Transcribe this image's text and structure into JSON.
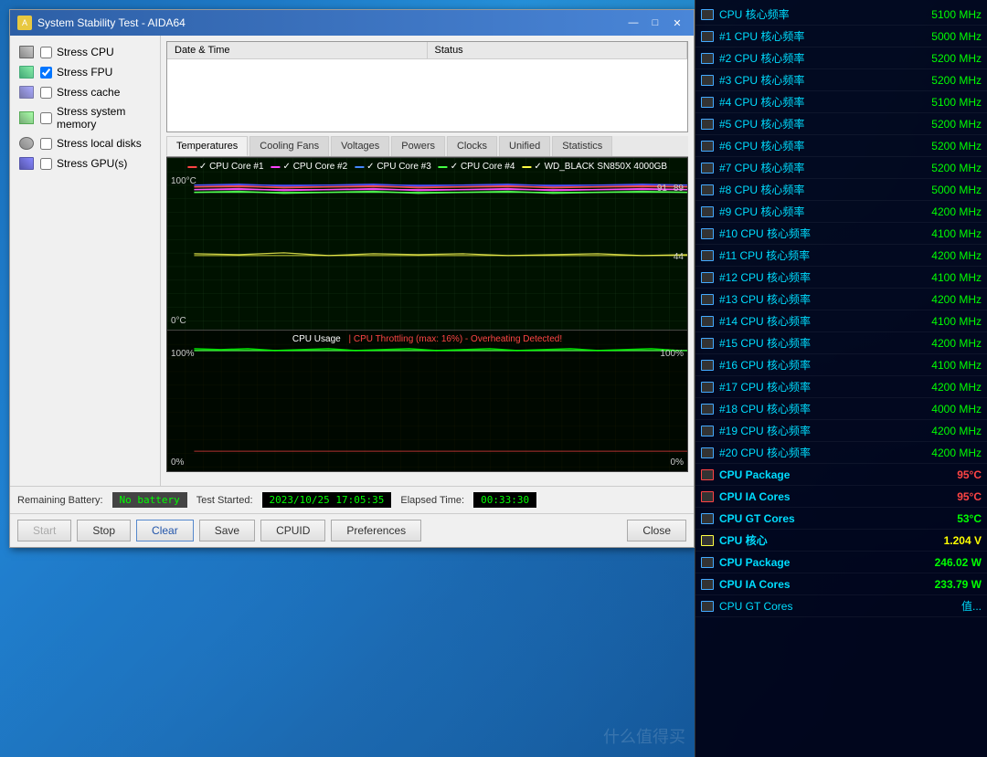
{
  "window": {
    "title": "System Stability Test - AIDA64",
    "icon": "A"
  },
  "controls": {
    "title_buttons": {
      "minimize": "—",
      "maximize": "□",
      "close": "✕"
    }
  },
  "checkboxes": [
    {
      "id": "stress_cpu",
      "label": "Stress CPU",
      "checked": false,
      "icon": "cpu"
    },
    {
      "id": "stress_fpu",
      "label": "Stress FPU",
      "checked": true,
      "icon": "fpu"
    },
    {
      "id": "stress_cache",
      "label": "Stress cache",
      "checked": false,
      "icon": "cache"
    },
    {
      "id": "stress_memory",
      "label": "Stress system memory",
      "checked": false,
      "icon": "mem"
    },
    {
      "id": "stress_disks",
      "label": "Stress local disks",
      "checked": false,
      "icon": "disk"
    },
    {
      "id": "stress_gpu",
      "label": "Stress GPU(s)",
      "checked": false,
      "icon": "gpu"
    }
  ],
  "log": {
    "columns": [
      "Date & Time",
      "Status"
    ],
    "rows": []
  },
  "tabs": [
    {
      "id": "temperatures",
      "label": "Temperatures",
      "active": true
    },
    {
      "id": "cooling_fans",
      "label": "Cooling Fans",
      "active": false
    },
    {
      "id": "voltages",
      "label": "Voltages",
      "active": false
    },
    {
      "id": "powers",
      "label": "Powers",
      "active": false
    },
    {
      "id": "clocks",
      "label": "Clocks",
      "active": false
    },
    {
      "id": "unified",
      "label": "Unified",
      "active": false
    },
    {
      "id": "statistics",
      "label": "Statistics",
      "active": false
    }
  ],
  "temp_chart": {
    "y_max": "100°C",
    "y_min": "0°C",
    "val_91": "91",
    "val_89": "89",
    "val_44": "44",
    "legend": [
      {
        "label": "CPU Core #1",
        "color": "#ff4444"
      },
      {
        "label": "CPU Core #2",
        "color": "#ff44ff"
      },
      {
        "label": "CPU Core #3",
        "color": "#4444ff"
      },
      {
        "label": "CPU Core #4",
        "color": "#44ff44"
      },
      {
        "label": "WD_BLACK SN850X 4000GB",
        "color": "#ffff44"
      }
    ]
  },
  "cpu_chart": {
    "title_normal": "CPU Usage",
    "title_throttle": "CPU Throttling (max: 16%) - Overheating Detected!",
    "y_max_left": "100%",
    "y_min_left": "0%",
    "y_max_right": "100%",
    "y_min_right": "0%"
  },
  "status_bar": {
    "battery_label": "Remaining Battery:",
    "battery_value": "No battery",
    "started_label": "Test Started:",
    "started_value": "2023/10/25 17:05:35",
    "elapsed_label": "Elapsed Time:",
    "elapsed_value": "00:33:30"
  },
  "buttons": [
    {
      "id": "start",
      "label": "Start",
      "disabled": true
    },
    {
      "id": "stop",
      "label": "Stop",
      "disabled": false
    },
    {
      "id": "clear",
      "label": "Clear",
      "disabled": false
    },
    {
      "id": "save",
      "label": "Save",
      "disabled": false
    },
    {
      "id": "cpuid",
      "label": "CPUID",
      "disabled": false
    },
    {
      "id": "preferences",
      "label": "Preferences",
      "disabled": false
    },
    {
      "id": "close",
      "label": "Close",
      "disabled": false
    }
  ],
  "stats": [
    {
      "name": "CPU 核心频率",
      "value": "5100 MHz",
      "color": "green"
    },
    {
      "name": "#1 CPU 核心频率",
      "value": "5000 MHz",
      "color": "green"
    },
    {
      "name": "#2 CPU 核心频率",
      "value": "5200 MHz",
      "color": "green"
    },
    {
      "name": "#3 CPU 核心频率",
      "value": "5200 MHz",
      "color": "green"
    },
    {
      "name": "#4 CPU 核心频率",
      "value": "5100 MHz",
      "color": "green"
    },
    {
      "name": "#5 CPU 核心频率",
      "value": "5200 MHz",
      "color": "green"
    },
    {
      "name": "#6 CPU 核心频率",
      "value": "5200 MHz",
      "color": "green"
    },
    {
      "name": "#7 CPU 核心频率",
      "value": "5200 MHz",
      "color": "green"
    },
    {
      "name": "#8 CPU 核心频率",
      "value": "5000 MHz",
      "color": "green"
    },
    {
      "name": "#9 CPU 核心频率",
      "value": "4200 MHz",
      "color": "green"
    },
    {
      "name": "#10 CPU 核心频率",
      "value": "4100 MHz",
      "color": "green"
    },
    {
      "name": "#11 CPU 核心频率",
      "value": "4200 MHz",
      "color": "green"
    },
    {
      "name": "#12 CPU 核心频率",
      "value": "4100 MHz",
      "color": "green"
    },
    {
      "name": "#13 CPU 核心频率",
      "value": "4200 MHz",
      "color": "green"
    },
    {
      "name": "#14 CPU 核心频率",
      "value": "4100 MHz",
      "color": "green"
    },
    {
      "name": "#15 CPU 核心频率",
      "value": "4200 MHz",
      "color": "green"
    },
    {
      "name": "#16 CPU 核心频率",
      "value": "4100 MHz",
      "color": "green"
    },
    {
      "name": "#17 CPU 核心频率",
      "value": "4200 MHz",
      "color": "green"
    },
    {
      "name": "#18 CPU 核心频率",
      "value": "4000 MHz",
      "color": "green"
    },
    {
      "name": "#19 CPU 核心频率",
      "value": "4200 MHz",
      "color": "green"
    },
    {
      "name": "#20 CPU 核心频率",
      "value": "4200 MHz",
      "color": "green"
    },
    {
      "name": "CPU Package",
      "value": "95°C",
      "color": "red",
      "bold": true
    },
    {
      "name": "CPU IA Cores",
      "value": "95°C",
      "color": "red",
      "bold": true
    },
    {
      "name": "CPU GT Cores",
      "value": "53°C",
      "color": "green",
      "bold": true
    },
    {
      "name": "CPU 核心",
      "value": "1.204 V",
      "color": "yellow",
      "bold": true
    },
    {
      "name": "CPU Package",
      "value": "246.02 W",
      "color": "green",
      "bold": true
    },
    {
      "name": "CPU IA Cores",
      "value": "233.79 W",
      "color": "green",
      "bold": true
    },
    {
      "name": "CPU GT Cores",
      "value": "值...",
      "color": "cyan",
      "bold": false
    }
  ]
}
